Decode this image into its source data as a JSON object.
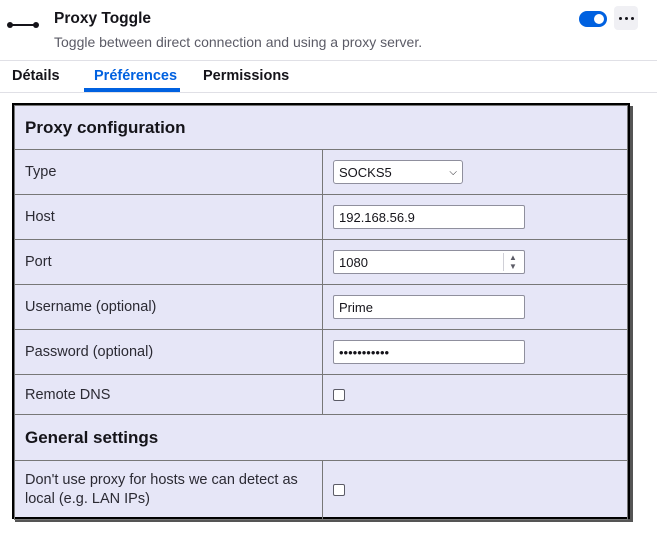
{
  "extension": {
    "name": "Proxy Toggle",
    "description": "Toggle between direct connection and using a proxy server.",
    "icon": "proxy-toggle-icon",
    "enabled": true
  },
  "tabs": [
    {
      "label": "Détails",
      "selected": false
    },
    {
      "label": "Préférences",
      "selected": true
    },
    {
      "label": "Permissions",
      "selected": false
    }
  ],
  "proxy_section": {
    "title": "Proxy configuration"
  },
  "fields": {
    "type": {
      "label": "Type",
      "value": "SOCKS5"
    },
    "host": {
      "label": "Host",
      "value": "192.168.56.9"
    },
    "port": {
      "label": "Port",
      "value": "1080"
    },
    "username": {
      "label": "Username (optional)",
      "value": "Prime"
    },
    "password": {
      "label": "Password (optional)",
      "value": "•••••••••••"
    },
    "remote_dns": {
      "label": "Remote DNS",
      "checked": false
    }
  },
  "general_section": {
    "title": "General settings"
  },
  "general": {
    "no_proxy_local": {
      "label": "Don't use proxy for hosts we can detect as local (e.g. LAN IPs)",
      "checked": false
    }
  },
  "colors": {
    "accent": "#0061e0",
    "panel_bg": "#e6e6f7"
  }
}
